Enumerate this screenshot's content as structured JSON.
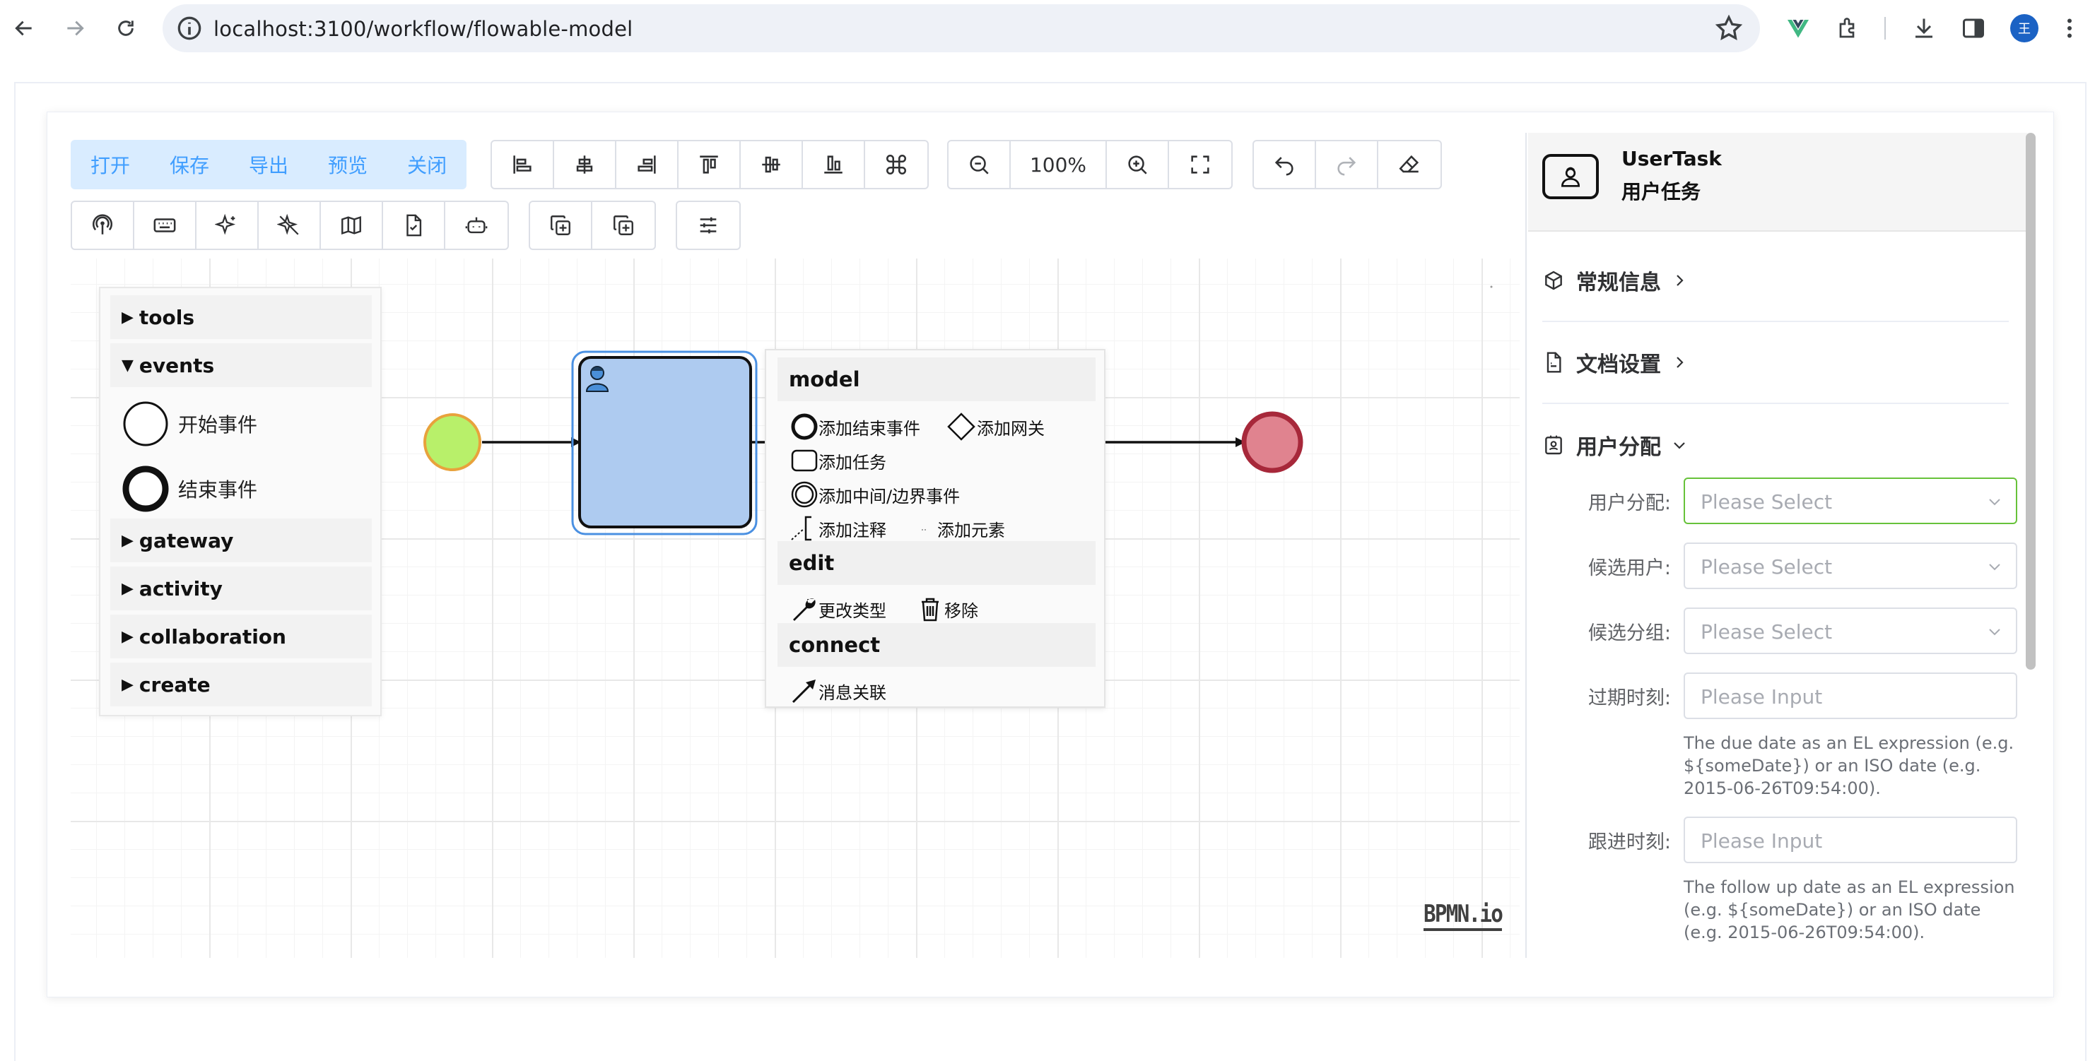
{
  "browser": {
    "url": "localhost:3100/workflow/flowable-model",
    "avatar_initial": "王"
  },
  "toolbar": {
    "primary": [
      "打开",
      "保存",
      "导出",
      "预览",
      "关闭"
    ],
    "zoom_label": "100%"
  },
  "palette": {
    "groups": {
      "tools": "tools",
      "events": "events",
      "gateway": "gateway",
      "activity": "activity",
      "collaboration": "collaboration",
      "create": "create"
    },
    "events_items": [
      "开始事件",
      "结束事件"
    ]
  },
  "context_pad": {
    "model": "model",
    "model_items": [
      "添加结束事件",
      "添加网关",
      "添加任务",
      "添加中间/边界事件",
      "添加注释",
      "添加元素"
    ],
    "edit": "edit",
    "edit_items": [
      "更改类型",
      "移除"
    ],
    "connect": "connect",
    "connect_items": [
      "消息关联"
    ]
  },
  "logo": "BPMN.io",
  "properties": {
    "element_type": "UserTask",
    "element_name": "用户任务",
    "sections": [
      "常规信息",
      "文档设置",
      "用户分配"
    ],
    "fields": {
      "assignee_label": "用户分配:",
      "assignee_placeholder": "Please Select",
      "candidate_users_label": "候选用户:",
      "candidate_users_placeholder": "Please Select",
      "candidate_groups_label": "候选分组:",
      "candidate_groups_placeholder": "Please Select",
      "due_date_label": "过期时刻:",
      "due_date_placeholder": "Please Input",
      "due_date_hint": "The due date as an EL expression (e.g. ${someDate}) or an ISO date (e.g. 2015-06-26T09:54:00).",
      "follow_up_label": "跟进时刻:",
      "follow_up_placeholder": "Please Input",
      "follow_up_hint": "The follow up date as an EL expression (e.g. ${someDate}) or an ISO date (e.g. 2015-06-26T09:54:00)."
    }
  },
  "colors": {
    "primary": "#409eff",
    "start_event_fill": "#b8f06a",
    "start_event_stroke": "#e8a23c",
    "end_event_fill": "#e0838f",
    "end_event_stroke": "#a7283a",
    "task_fill": "#aecbf0",
    "selection": "#4a90e2"
  }
}
